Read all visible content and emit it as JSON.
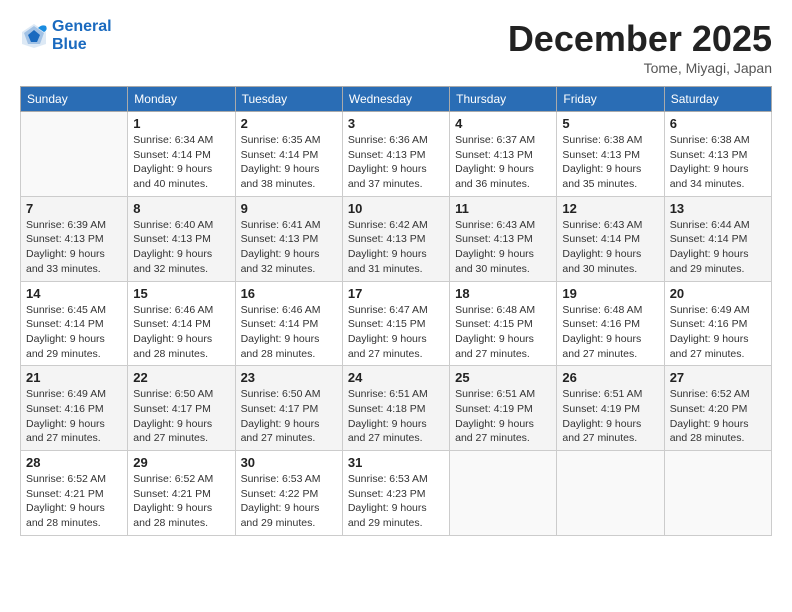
{
  "header": {
    "logo_line1": "General",
    "logo_line2": "Blue",
    "month": "December 2025",
    "location": "Tome, Miyagi, Japan"
  },
  "weekdays": [
    "Sunday",
    "Monday",
    "Tuesday",
    "Wednesday",
    "Thursday",
    "Friday",
    "Saturday"
  ],
  "weeks": [
    [
      {
        "day": "",
        "info": ""
      },
      {
        "day": "1",
        "info": "Sunrise: 6:34 AM\nSunset: 4:14 PM\nDaylight: 9 hours\nand 40 minutes."
      },
      {
        "day": "2",
        "info": "Sunrise: 6:35 AM\nSunset: 4:14 PM\nDaylight: 9 hours\nand 38 minutes."
      },
      {
        "day": "3",
        "info": "Sunrise: 6:36 AM\nSunset: 4:13 PM\nDaylight: 9 hours\nand 37 minutes."
      },
      {
        "day": "4",
        "info": "Sunrise: 6:37 AM\nSunset: 4:13 PM\nDaylight: 9 hours\nand 36 minutes."
      },
      {
        "day": "5",
        "info": "Sunrise: 6:38 AM\nSunset: 4:13 PM\nDaylight: 9 hours\nand 35 minutes."
      },
      {
        "day": "6",
        "info": "Sunrise: 6:38 AM\nSunset: 4:13 PM\nDaylight: 9 hours\nand 34 minutes."
      }
    ],
    [
      {
        "day": "7",
        "info": "Sunrise: 6:39 AM\nSunset: 4:13 PM\nDaylight: 9 hours\nand 33 minutes."
      },
      {
        "day": "8",
        "info": "Sunrise: 6:40 AM\nSunset: 4:13 PM\nDaylight: 9 hours\nand 32 minutes."
      },
      {
        "day": "9",
        "info": "Sunrise: 6:41 AM\nSunset: 4:13 PM\nDaylight: 9 hours\nand 32 minutes."
      },
      {
        "day": "10",
        "info": "Sunrise: 6:42 AM\nSunset: 4:13 PM\nDaylight: 9 hours\nand 31 minutes."
      },
      {
        "day": "11",
        "info": "Sunrise: 6:43 AM\nSunset: 4:13 PM\nDaylight: 9 hours\nand 30 minutes."
      },
      {
        "day": "12",
        "info": "Sunrise: 6:43 AM\nSunset: 4:14 PM\nDaylight: 9 hours\nand 30 minutes."
      },
      {
        "day": "13",
        "info": "Sunrise: 6:44 AM\nSunset: 4:14 PM\nDaylight: 9 hours\nand 29 minutes."
      }
    ],
    [
      {
        "day": "14",
        "info": "Sunrise: 6:45 AM\nSunset: 4:14 PM\nDaylight: 9 hours\nand 29 minutes."
      },
      {
        "day": "15",
        "info": "Sunrise: 6:46 AM\nSunset: 4:14 PM\nDaylight: 9 hours\nand 28 minutes."
      },
      {
        "day": "16",
        "info": "Sunrise: 6:46 AM\nSunset: 4:14 PM\nDaylight: 9 hours\nand 28 minutes."
      },
      {
        "day": "17",
        "info": "Sunrise: 6:47 AM\nSunset: 4:15 PM\nDaylight: 9 hours\nand 27 minutes."
      },
      {
        "day": "18",
        "info": "Sunrise: 6:48 AM\nSunset: 4:15 PM\nDaylight: 9 hours\nand 27 minutes."
      },
      {
        "day": "19",
        "info": "Sunrise: 6:48 AM\nSunset: 4:16 PM\nDaylight: 9 hours\nand 27 minutes."
      },
      {
        "day": "20",
        "info": "Sunrise: 6:49 AM\nSunset: 4:16 PM\nDaylight: 9 hours\nand 27 minutes."
      }
    ],
    [
      {
        "day": "21",
        "info": "Sunrise: 6:49 AM\nSunset: 4:16 PM\nDaylight: 9 hours\nand 27 minutes."
      },
      {
        "day": "22",
        "info": "Sunrise: 6:50 AM\nSunset: 4:17 PM\nDaylight: 9 hours\nand 27 minutes."
      },
      {
        "day": "23",
        "info": "Sunrise: 6:50 AM\nSunset: 4:17 PM\nDaylight: 9 hours\nand 27 minutes."
      },
      {
        "day": "24",
        "info": "Sunrise: 6:51 AM\nSunset: 4:18 PM\nDaylight: 9 hours\nand 27 minutes."
      },
      {
        "day": "25",
        "info": "Sunrise: 6:51 AM\nSunset: 4:19 PM\nDaylight: 9 hours\nand 27 minutes."
      },
      {
        "day": "26",
        "info": "Sunrise: 6:51 AM\nSunset: 4:19 PM\nDaylight: 9 hours\nand 27 minutes."
      },
      {
        "day": "27",
        "info": "Sunrise: 6:52 AM\nSunset: 4:20 PM\nDaylight: 9 hours\nand 28 minutes."
      }
    ],
    [
      {
        "day": "28",
        "info": "Sunrise: 6:52 AM\nSunset: 4:21 PM\nDaylight: 9 hours\nand 28 minutes."
      },
      {
        "day": "29",
        "info": "Sunrise: 6:52 AM\nSunset: 4:21 PM\nDaylight: 9 hours\nand 28 minutes."
      },
      {
        "day": "30",
        "info": "Sunrise: 6:53 AM\nSunset: 4:22 PM\nDaylight: 9 hours\nand 29 minutes."
      },
      {
        "day": "31",
        "info": "Sunrise: 6:53 AM\nSunset: 4:23 PM\nDaylight: 9 hours\nand 29 minutes."
      },
      {
        "day": "",
        "info": ""
      },
      {
        "day": "",
        "info": ""
      },
      {
        "day": "",
        "info": ""
      }
    ]
  ]
}
